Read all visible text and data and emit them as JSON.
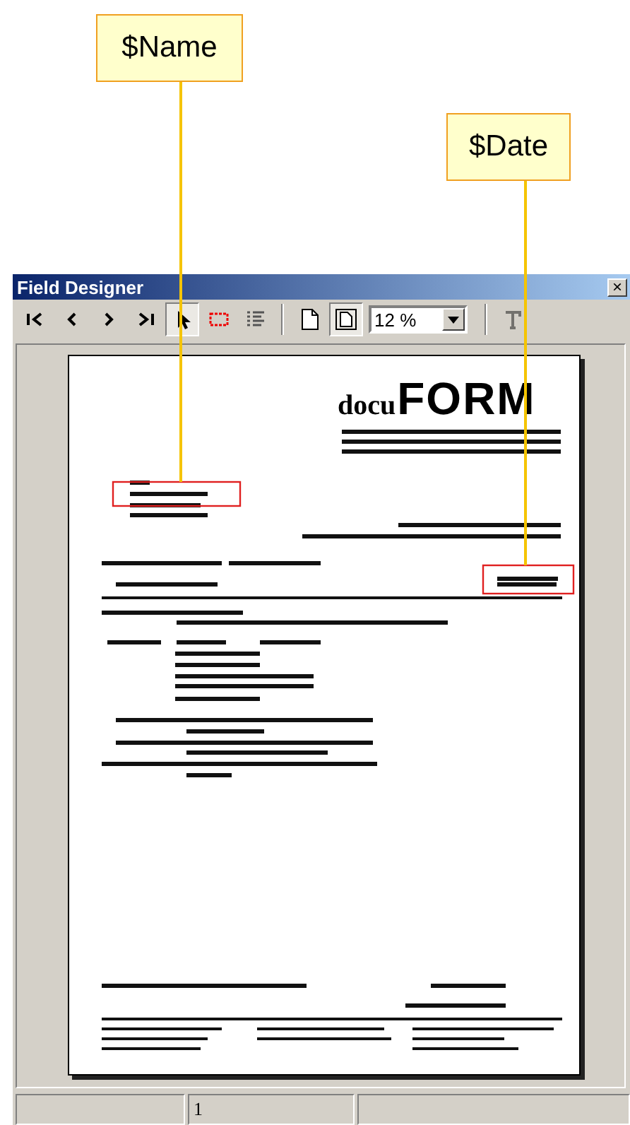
{
  "callouts": [
    {
      "label": "$Name"
    },
    {
      "label": "$Date"
    }
  ],
  "window": {
    "title": "Field Designer",
    "close": "×"
  },
  "toolbar": [
    {
      "kind": "first",
      "pressed": false,
      "disabled": false
    },
    {
      "kind": "prev",
      "pressed": false,
      "disabled": false
    },
    {
      "kind": "next",
      "pressed": false,
      "disabled": false
    },
    {
      "kind": "last",
      "pressed": false,
      "disabled": false
    },
    {
      "kind": "pointer",
      "pressed": true,
      "disabled": false
    },
    {
      "kind": "frame",
      "pressed": false,
      "disabled": false
    },
    {
      "kind": "list",
      "pressed": false,
      "disabled": false
    },
    {
      "kind": "separator"
    },
    {
      "kind": "page",
      "pressed": false,
      "disabled": false
    },
    {
      "kind": "page-framed",
      "pressed": true,
      "disabled": false
    },
    {
      "kind": "zoom"
    },
    {
      "kind": "separator"
    },
    {
      "kind": "text",
      "pressed": false,
      "disabled": true
    }
  ],
  "zoom": {
    "value": "12 %"
  },
  "document": {
    "logo_prefix": "docu",
    "logo_main": "FORM"
  },
  "status_bar": {
    "page": "1"
  }
}
